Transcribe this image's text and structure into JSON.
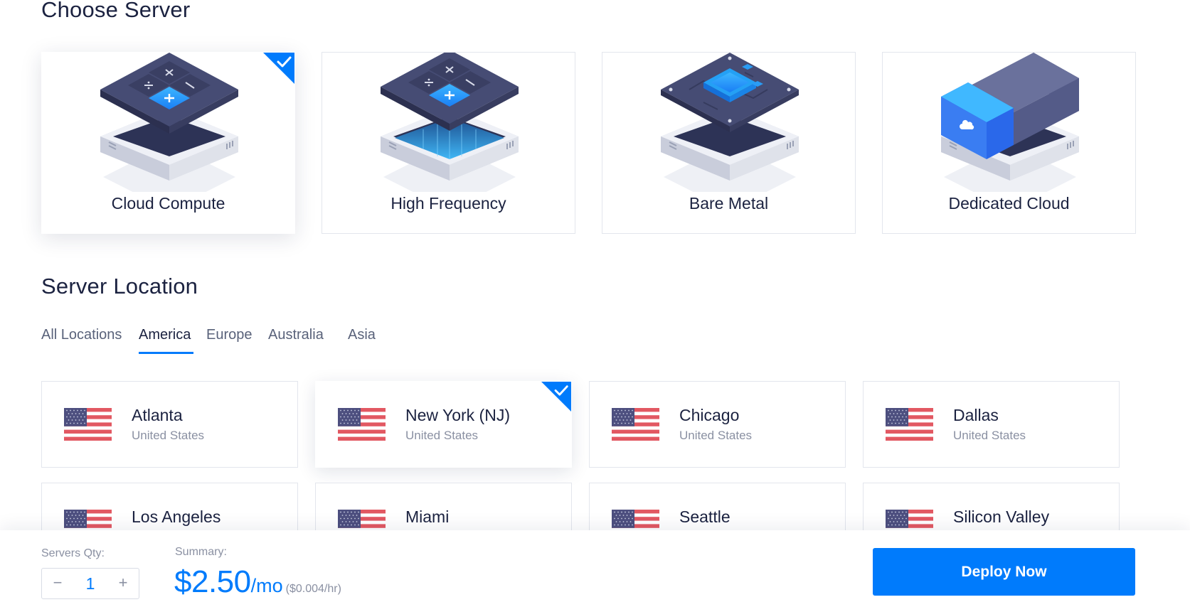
{
  "sections": {
    "choose_server": "Choose Server",
    "server_location": "Server Location"
  },
  "server_types": [
    {
      "label": "Cloud Compute",
      "selected": true,
      "icon": "calculator-server-icon"
    },
    {
      "label": "High Frequency",
      "selected": false,
      "icon": "calculator-server-glow-icon"
    },
    {
      "label": "Bare Metal",
      "selected": false,
      "icon": "chip-server-icon"
    },
    {
      "label": "Dedicated Cloud",
      "selected": false,
      "icon": "cloud-blade-server-icon"
    }
  ],
  "location_tabs": [
    {
      "label": "All Locations",
      "active": false
    },
    {
      "label": "America",
      "active": true
    },
    {
      "label": "Europe",
      "active": false
    },
    {
      "label": "Australia",
      "active": false
    },
    {
      "label": "Asia",
      "active": false
    }
  ],
  "locations": [
    {
      "city": "Atlanta",
      "country": "United States",
      "selected": false
    },
    {
      "city": "New York (NJ)",
      "country": "United States",
      "selected": true
    },
    {
      "city": "Chicago",
      "country": "United States",
      "selected": false
    },
    {
      "city": "Dallas",
      "country": "United States",
      "selected": false
    },
    {
      "city": "Los Angeles",
      "country": "",
      "selected": false
    },
    {
      "city": "Miami",
      "country": "",
      "selected": false
    },
    {
      "city": "Seattle",
      "country": "",
      "selected": false
    },
    {
      "city": "Silicon Valley",
      "country": "",
      "selected": false
    }
  ],
  "bottom_bar": {
    "qty_label": "Servers Qty:",
    "qty_minus": "−",
    "qty_value": "1",
    "qty_plus": "+",
    "summary_label": "Summary:",
    "price_amount": "$2.50",
    "price_period": "/mo",
    "price_hourly": "($0.004/hr)",
    "deploy_label": "Deploy Now"
  },
  "colors": {
    "accent": "#007bfc",
    "text_dark": "#1b2240",
    "text_muted": "#8a90a2",
    "border": "#e3e6ed"
  }
}
